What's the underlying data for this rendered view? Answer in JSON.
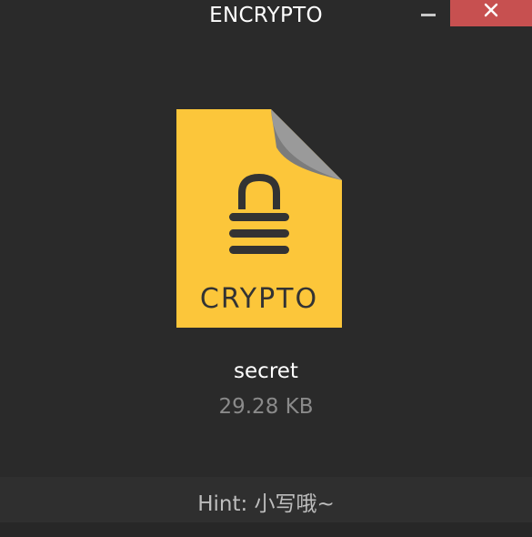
{
  "window": {
    "title": "ENCRYPTO"
  },
  "controls": {
    "minimize_icon": "minimize-icon",
    "close_icon": "close-icon",
    "close_color": "#c75050"
  },
  "file": {
    "icon_label": "CRYPTO",
    "icon_color": "#fcc63a",
    "name": "secret",
    "size": "29.28 KB"
  },
  "hint": {
    "text": "Hint: 小写哦~"
  }
}
